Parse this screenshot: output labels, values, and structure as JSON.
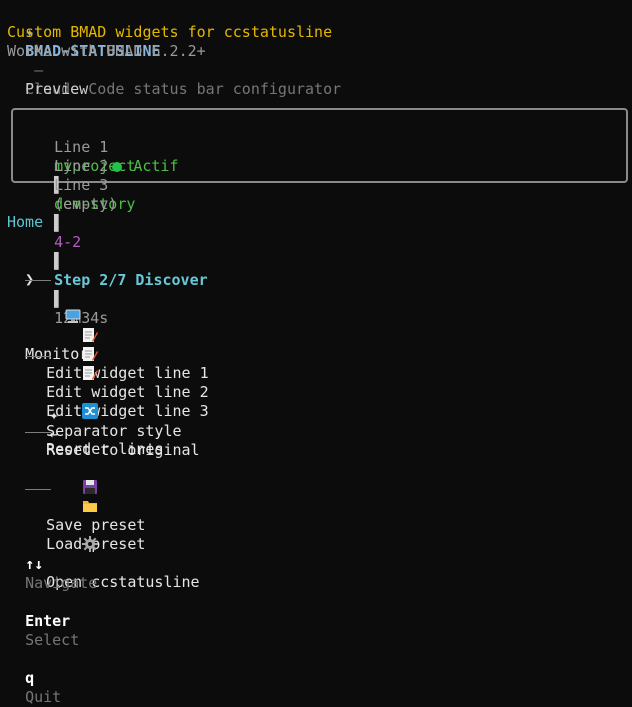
{
  "header": {
    "logo_glyph": "✦",
    "app_name": "BMAD-STATUSLINE",
    "separator": " — ",
    "description": "Claude Code status bar configurator",
    "tagline": "Custom BMAD widgets for ccstatusline",
    "version_note": "Works with BMAD 6.2.2+"
  },
  "preview": {
    "label": "Preview",
    "line1": {
      "label": "Line 1",
      "project": "myproject",
      "bar": "▌",
      "workflow": "dev-story",
      "story": "4-2",
      "step": "Step 2/7 Discover",
      "timer": "12m34s"
    },
    "line2": {
      "label": "Line 2",
      "status": "Actif",
      "status_color": "#23c24b"
    },
    "line3": {
      "label": "Line 3",
      "value": "(empty)"
    }
  },
  "menu": {
    "title": "Home",
    "caret": "❯",
    "items": [
      {
        "label": "Monitor",
        "icon": "monitor-icon"
      },
      {
        "label": "Edit widget line 1",
        "icon": "memo-icon"
      },
      {
        "label": "Edit widget line 2",
        "icon": "memo-icon"
      },
      {
        "label": "Edit widget line 3",
        "icon": "memo-icon"
      },
      {
        "label": "Reorder lines",
        "icon": "shuffle-icon"
      },
      {
        "label": "Separator style",
        "icon": "sparkle-icon"
      },
      {
        "label": "Reset to original",
        "icon": "return-icon"
      },
      {
        "label": "Save preset",
        "icon": "floppy-icon"
      },
      {
        "label": "Load preset",
        "icon": "folder-icon"
      },
      {
        "label": "Open ccstatusline",
        "icon": "gear-icon"
      }
    ],
    "selected_index": 0,
    "sparkle_glyph": "✦",
    "return_glyph": "↩"
  },
  "footer": {
    "nav_keys": "↑↓",
    "nav_label": "Navigate",
    "enter_key": "Enter",
    "enter_label": "Select",
    "quit_key": "q",
    "quit_label": "Quit"
  },
  "colors": {
    "background": "#0c0c0c",
    "accent_yellow": "#e5b800",
    "accent_cyan": "#68c8d8",
    "accent_green": "#4dbe46",
    "accent_magenta": "#b35fbf"
  }
}
